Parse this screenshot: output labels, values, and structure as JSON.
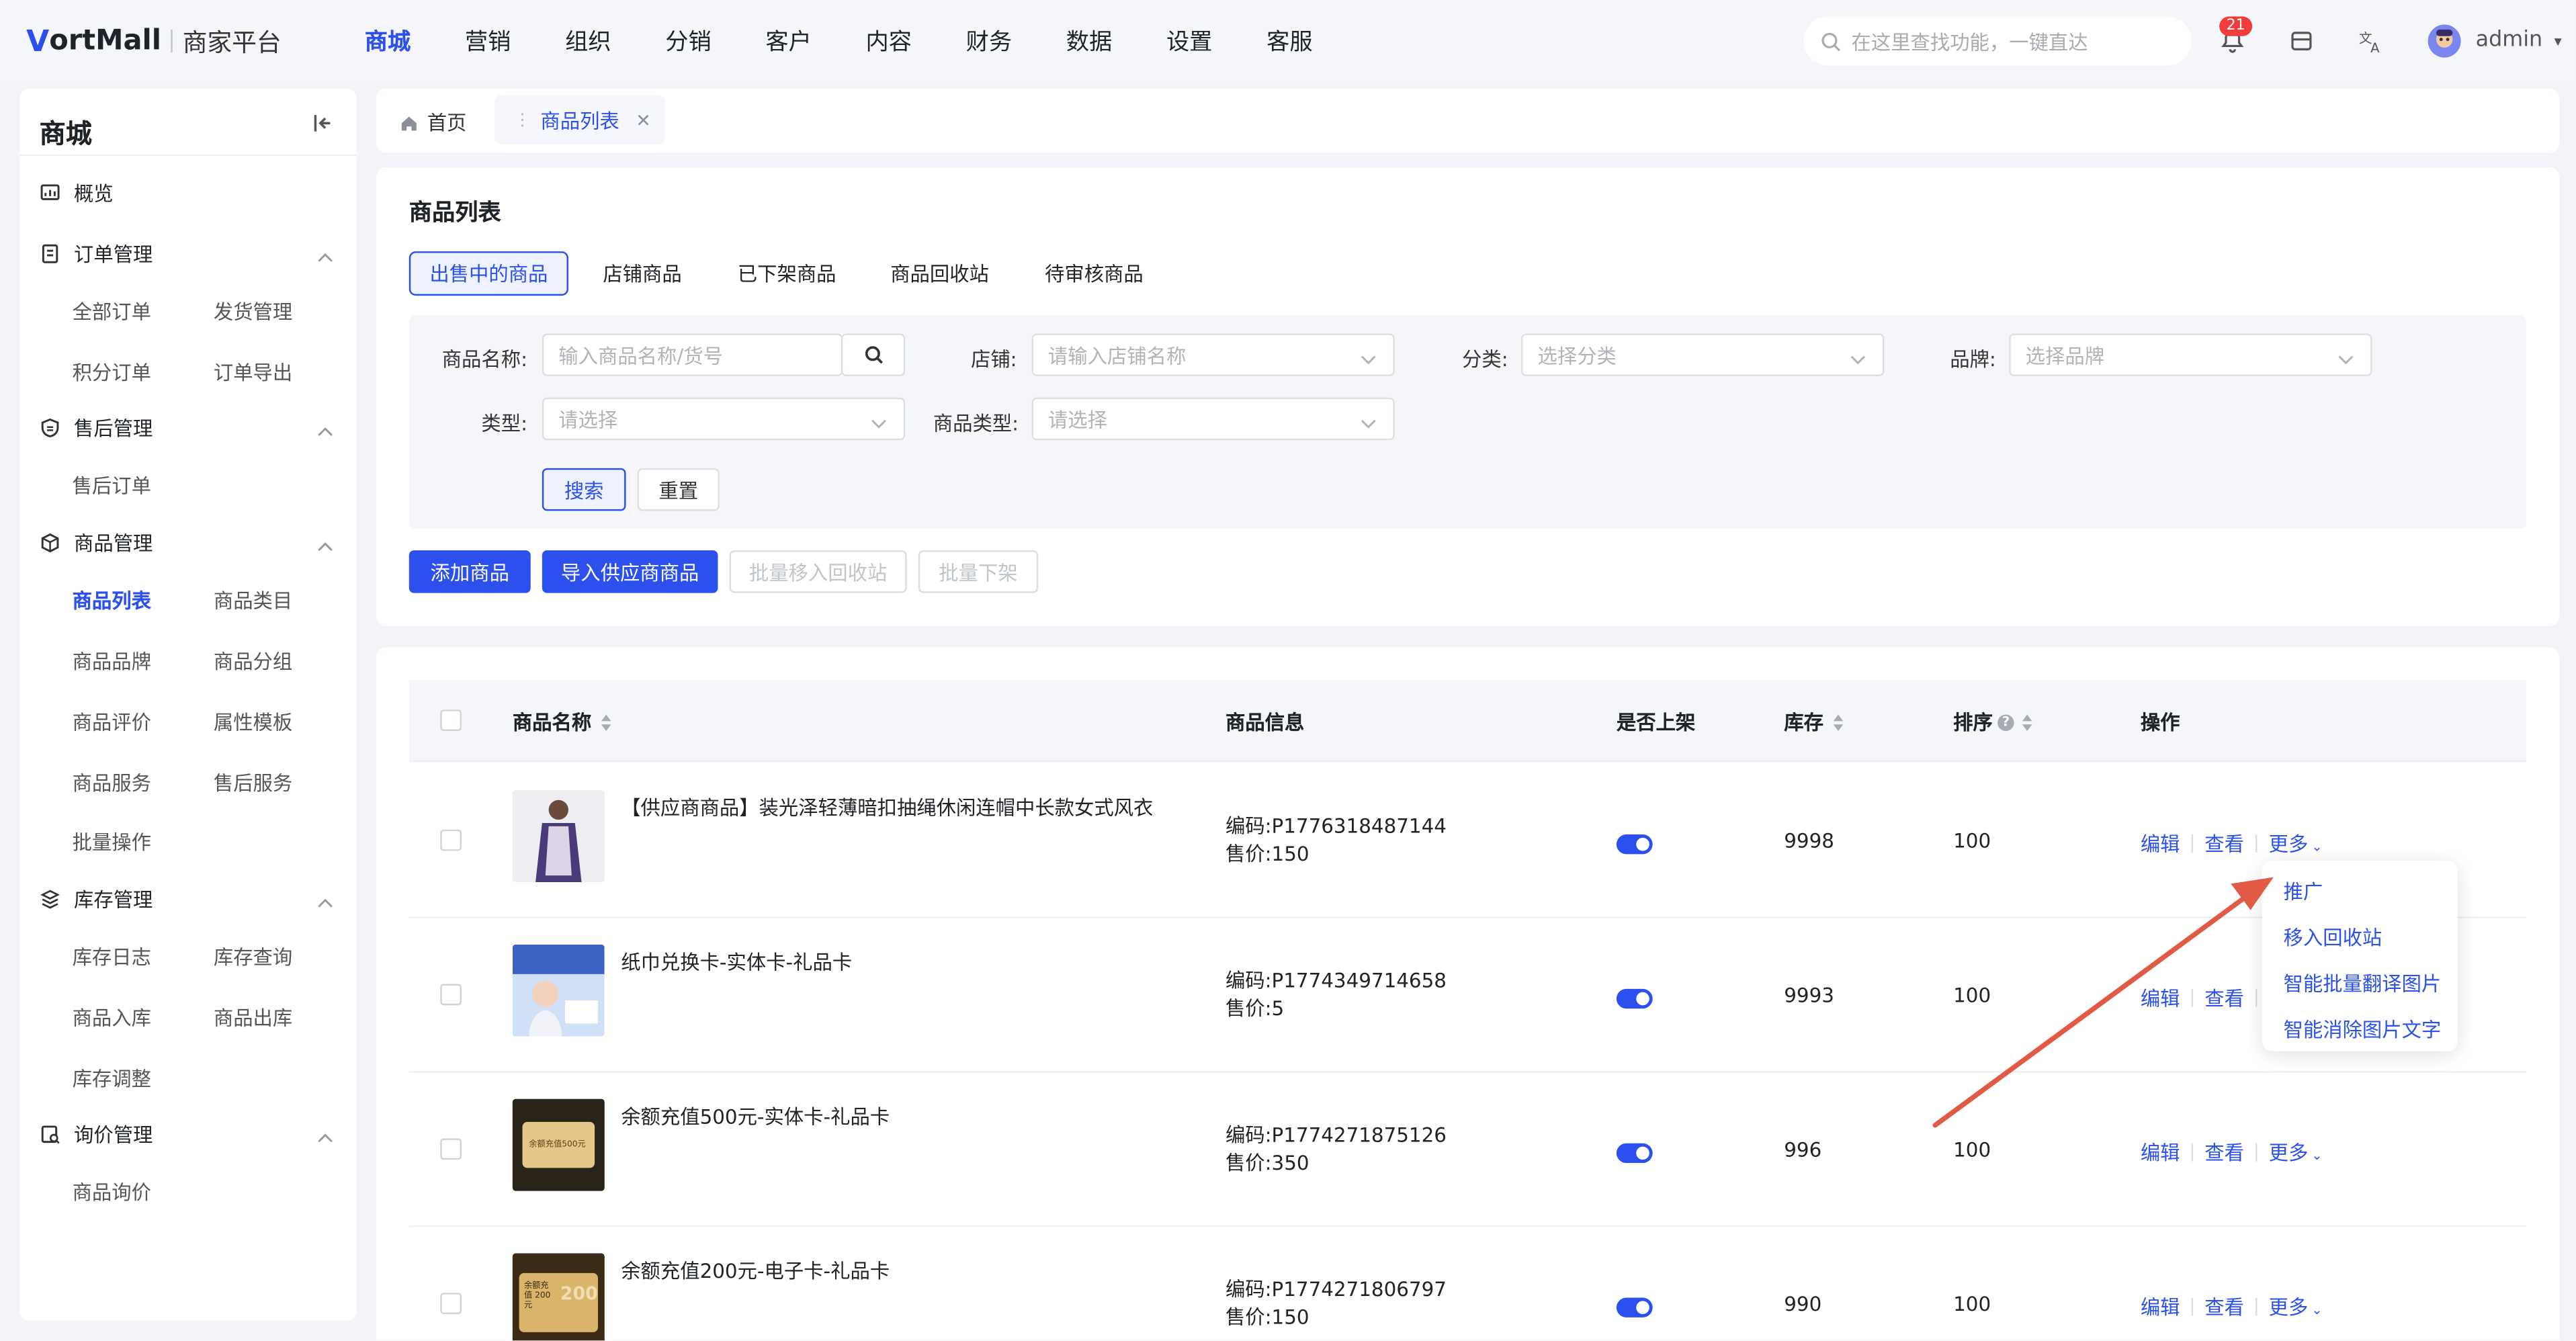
{
  "app": {
    "logo_mark": "V",
    "logo_name": "ortMall",
    "logo_sub": "商家平台"
  },
  "nav": {
    "items": [
      "商城",
      "营销",
      "组织",
      "分销",
      "客户",
      "内容",
      "财务",
      "数据",
      "设置",
      "客服"
    ],
    "active": "商城"
  },
  "search": {
    "placeholder": "在这里查找功能，一键直达"
  },
  "notifications": {
    "count": "21"
  },
  "user": {
    "name": "admin"
  },
  "sidebar": {
    "title": "商城",
    "overview": "概览",
    "groups": [
      {
        "label": "订单管理",
        "icon": "order-icon",
        "items": [
          "全部订单",
          "发货管理",
          "积分订单",
          "订单导出"
        ]
      },
      {
        "label": "售后管理",
        "icon": "after-sale-icon",
        "items": [
          "售后订单"
        ]
      },
      {
        "label": "商品管理",
        "icon": "goods-icon",
        "items": [
          "商品列表",
          "商品类目",
          "商品品牌",
          "商品分组",
          "商品评价",
          "属性模板",
          "商品服务",
          "售后服务",
          "批量操作"
        ]
      },
      {
        "label": "库存管理",
        "icon": "stock-icon",
        "items": [
          "库存日志",
          "库存查询",
          "商品入库",
          "商品出库",
          "库存调整"
        ]
      },
      {
        "label": "询价管理",
        "icon": "inquiry-icon",
        "items": [
          "商品询价"
        ]
      }
    ],
    "active_item": "商品列表"
  },
  "page_tabs": {
    "home": "首页",
    "active": "商品列表"
  },
  "filter_card": {
    "title": "商品列表",
    "status_tabs": [
      "出售中的商品",
      "店铺商品",
      "已下架商品",
      "商品回收站",
      "待审核商品"
    ],
    "fields": {
      "name_label": "商品名称:",
      "name_placeholder": "输入商品名称/货号",
      "shop_label": "店铺:",
      "shop_placeholder": "请输入店铺名称",
      "category_label": "分类:",
      "category_placeholder": "选择分类",
      "brand_label": "品牌:",
      "brand_placeholder": "选择品牌",
      "type_label": "类型:",
      "type_placeholder": "请选择",
      "goods_type_label": "商品类型:",
      "goods_type_placeholder": "请选择"
    },
    "search_btn": "搜索",
    "reset_btn": "重置",
    "actions": {
      "add": "添加商品",
      "import": "导入供应商商品",
      "batch_recycle": "批量移入回收站",
      "batch_offshelf": "批量下架"
    }
  },
  "table": {
    "headers": {
      "name": "商品名称",
      "info": "商品信息",
      "on_shelf": "是否上架",
      "stock": "库存",
      "sort": "排序",
      "ops": "操作"
    },
    "code_label": "编码:",
    "price_label": "售价:",
    "op_labels": {
      "edit": "编辑",
      "view": "查看",
      "more": "更多"
    },
    "rows": [
      {
        "name": "【供应商商品】装光泽轻薄暗扣抽绳休闲连帽中长款女式风衣",
        "code": "P1776318487144",
        "price": "150",
        "on_shelf": true,
        "stock": "9998",
        "sort": "100"
      },
      {
        "name": "纸巾兑换卡-实体卡-礼品卡",
        "code": "P1774349714658",
        "price": "5",
        "on_shelf": true,
        "stock": "9993",
        "sort": "100"
      },
      {
        "name": "余额充值500元-实体卡-礼品卡",
        "code": "P1774271875126",
        "price": "350",
        "on_shelf": true,
        "stock": "996",
        "sort": "100",
        "img_text": "余额充值500元"
      },
      {
        "name": "余额充值200元-电子卡-礼品卡",
        "code": "P1774271806797",
        "price": "150",
        "on_shelf": true,
        "stock": "990",
        "sort": "100",
        "img_text": "余额充值 200元",
        "img_big": "200"
      }
    ]
  },
  "more_menu": {
    "items": [
      "推广",
      "移入回收站",
      "智能批量翻译图片",
      "智能消除图片文字"
    ]
  }
}
